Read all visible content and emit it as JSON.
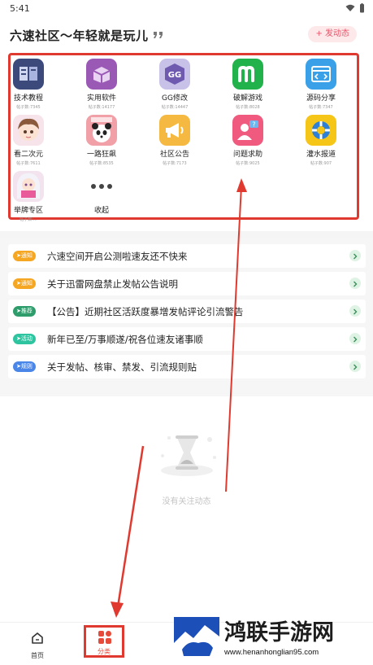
{
  "status_bar": {
    "time": "5:41"
  },
  "header": {
    "title": "六速社区～年轻就是玩儿",
    "post_button": "+ 发动态"
  },
  "categories": [
    {
      "name": "技术教程",
      "count": "帖子数:7345",
      "icon": "book-icon",
      "color": "#3b4a7a"
    },
    {
      "name": "实用软件",
      "count": "帖子数:14177",
      "icon": "box-icon",
      "color": "#9b59b6"
    },
    {
      "name": "GG修改",
      "count": "帖子数:14447",
      "icon": "gg-icon",
      "color": "#6e5bb0"
    },
    {
      "name": "破解游戏",
      "count": "帖子数:8028",
      "icon": "m-icon",
      "color": "#22b24c"
    },
    {
      "name": "源码分享",
      "count": "帖子数:7347",
      "icon": "code-icon",
      "color": "#3aa0e8"
    },
    {
      "name": "看二次元",
      "count": "帖子数:7611",
      "icon": "anime-girl-icon",
      "color": "#e9b8c8"
    },
    {
      "name": "一路狂飙",
      "count": "帖子数:8535",
      "icon": "panda-icon",
      "color": "#f2a0a8"
    },
    {
      "name": "社区公告",
      "count": "帖子数:7173",
      "icon": "megaphone-icon",
      "color": "#f5b942"
    },
    {
      "name": "问题求助",
      "count": "帖子数:9025",
      "icon": "help-person-icon",
      "color": "#f05a7e"
    },
    {
      "name": "灌水报道",
      "count": "帖子数:907",
      "icon": "lifebuoy-icon",
      "color": "#f5c518"
    },
    {
      "name": "举牌专区",
      "count": "帖子数:...",
      "icon": "sign-girl-icon",
      "color": "#f3e3ee"
    },
    {
      "name": "收起",
      "count": "",
      "icon": "more-dots-icon",
      "color": "#ffffff"
    }
  ],
  "notices": [
    {
      "badge": "通知",
      "badge_color": "#f5a623",
      "text": "六速空间开启公测啦速友还不快来"
    },
    {
      "badge": "通知",
      "badge_color": "#f5a623",
      "text": "关于迅雷网盘禁止发帖公告说明"
    },
    {
      "badge": "推荐",
      "badge_color": "#2e9d6b",
      "text": "【公告】近期社区活跃度暴增发帖评论引流警告"
    },
    {
      "badge": "活动",
      "badge_color": "#2ec4a0",
      "text": "新年已至/万事顺遂/祝各位速友诸事顺"
    },
    {
      "badge": "规则",
      "badge_color": "#4a86e8",
      "text": "关于发帖、核审、禁发、引流规则贴"
    }
  ],
  "empty_state": {
    "text": "没有关注动态"
  },
  "bottom_nav": {
    "home_label": "首页",
    "category_label": "分类"
  },
  "watermark": {
    "text": "鸿联手游网",
    "url": "www.henanhonglian95.com"
  },
  "colors": {
    "accent": "#e8556a",
    "annotation_red": "#e03a30",
    "page_bg": "#f6f6f6"
  }
}
